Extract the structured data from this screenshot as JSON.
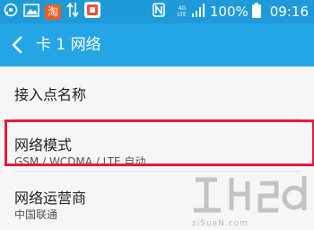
{
  "status_bar": {
    "network_type": "4G LTE",
    "battery": "100%",
    "time": "09:16",
    "taobao_label": "淘",
    "left_icons": [
      "whatsapp-icon",
      "image-icon",
      "taobao-icon",
      "data-transfer-icon",
      "app-icon"
    ],
    "right_icons": [
      "nfc-icon",
      "signal-icon",
      "battery-icon"
    ]
  },
  "app_bar": {
    "title": "卡 1 网络"
  },
  "items": [
    {
      "title": "接入点名称",
      "subtitle": ""
    },
    {
      "title": "网络模式",
      "subtitle": "GSM / WCDMA / LTE 自动"
    },
    {
      "title": "网络运营商",
      "subtitle": "中国联通"
    }
  ],
  "watermark": {
    "text": "ziSuaN.com"
  },
  "colors": {
    "status_bar": "#1e9ad8",
    "app_bar": "#23a5e6",
    "highlight": "#e51a3a",
    "background": "#f6f6f6"
  }
}
